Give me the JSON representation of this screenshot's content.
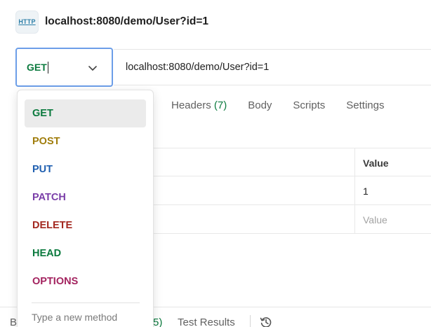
{
  "title": {
    "icon_label": "HTTP",
    "icon": "http-file-icon",
    "text": "localhost:8080/demo/User?id=1"
  },
  "request": {
    "method": "GET",
    "url": "localhost:8080/demo/User?id=1"
  },
  "tabs": [
    {
      "label": "Headers",
      "count": "(7)"
    },
    {
      "label": "Body",
      "count": ""
    },
    {
      "label": "Scripts",
      "count": ""
    },
    {
      "label": "Settings",
      "count": ""
    }
  ],
  "params": {
    "value_header": "Value",
    "rows": [
      {
        "value": "1"
      }
    ],
    "value_placeholder": "Value"
  },
  "methods_dropdown": {
    "items": [
      {
        "label": "GET",
        "color": "#0b7a3e",
        "selected": true
      },
      {
        "label": "POST",
        "color": "#a07d0c"
      },
      {
        "label": "PUT",
        "color": "#1f5fb0"
      },
      {
        "label": "PATCH",
        "color": "#7a3ea8"
      },
      {
        "label": "DELETE",
        "color": "#a3281f"
      },
      {
        "label": "HEAD",
        "color": "#0b7a3e"
      },
      {
        "label": "OPTIONS",
        "color": "#a3235f"
      }
    ],
    "new_method_placeholder": "Type a new method"
  },
  "bottom_bar": {
    "left_fragment": "B",
    "count_fragment": "5)",
    "test_results": "Test Results",
    "history_icon": "history-icon"
  },
  "colors": {
    "accent_focus": "#6c9ee8",
    "get_green": "#0b7a3e"
  }
}
